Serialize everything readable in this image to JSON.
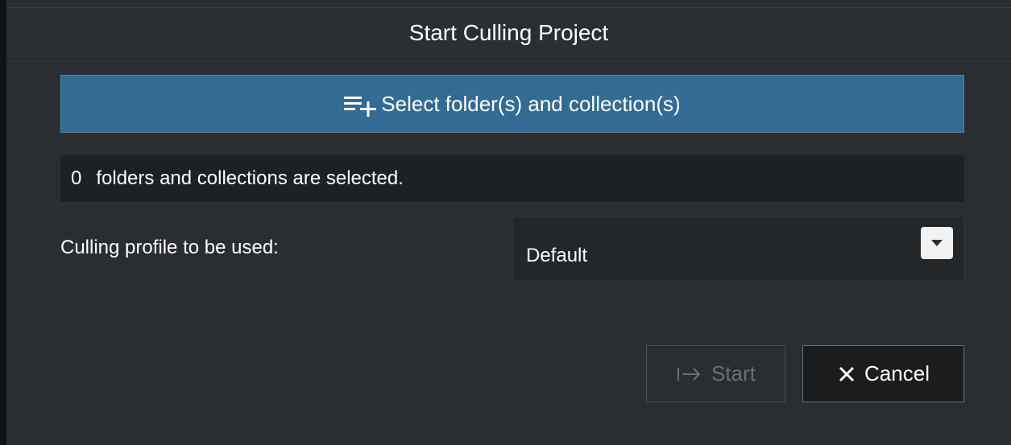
{
  "dialog": {
    "title": "Start Culling Project"
  },
  "select_button": {
    "label": "Select folder(s) and collection(s)",
    "icon": "list-add-icon"
  },
  "status": {
    "count": "0",
    "text": "folders and collections are selected."
  },
  "profile": {
    "label": "Culling profile to be used:",
    "selected": "Default",
    "icon": "chevron-down-icon"
  },
  "actions": {
    "start_label": "Start",
    "start_icon": "arrow-to-right-icon",
    "cancel_label": "Cancel",
    "cancel_icon": "close-icon"
  },
  "colors": {
    "accent": "#336b93",
    "background": "#2a2e32",
    "field": "#1e2124"
  }
}
